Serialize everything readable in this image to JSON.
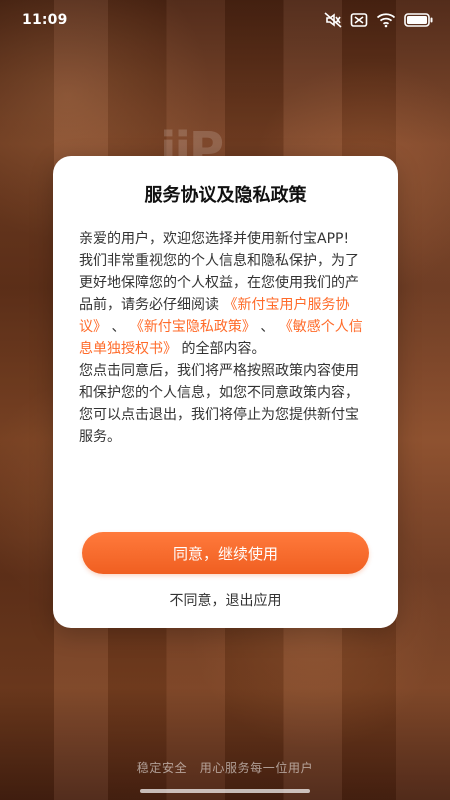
{
  "status_bar": {
    "time": "11:09",
    "icons": [
      "mute-icon",
      "no-sim-icon",
      "wifi-icon",
      "battery-icon"
    ]
  },
  "background": {
    "logo_text": "iiP"
  },
  "dialog": {
    "title": "服务协议及隐私政策",
    "body": {
      "greeting": "亲爱的用户，欢迎您选择并使用新付宝APP!",
      "intro": "我们非常重视您的个人信息和隐私保护，为了更好地保障您的个人权益，在您使用我们的产品前，请务必仔细阅读",
      "link_user_agreement": "《新付宝用户服务协议》",
      "separator_1": "、",
      "link_privacy_policy": "《新付宝隐私政策》",
      "separator_2": "、",
      "link_sensitive_info": "《敏感个人信息单独授权书》",
      "after_links": "的全部内容。",
      "consent_text": "您点击同意后，我们将严格按照政策内容使用和保护您的个人信息，如您不同意政策内容，您可以点击退出，我们将停止为您提供新付宝服务。"
    },
    "agree_button": "同意，继续使用",
    "decline_button": "不同意，退出应用"
  },
  "footer": {
    "slogan": "稳定安全　用心服务每一位用户"
  },
  "colors": {
    "accent": "#ff6b2a",
    "button": "#f26a2b",
    "background": "#6a361c"
  }
}
